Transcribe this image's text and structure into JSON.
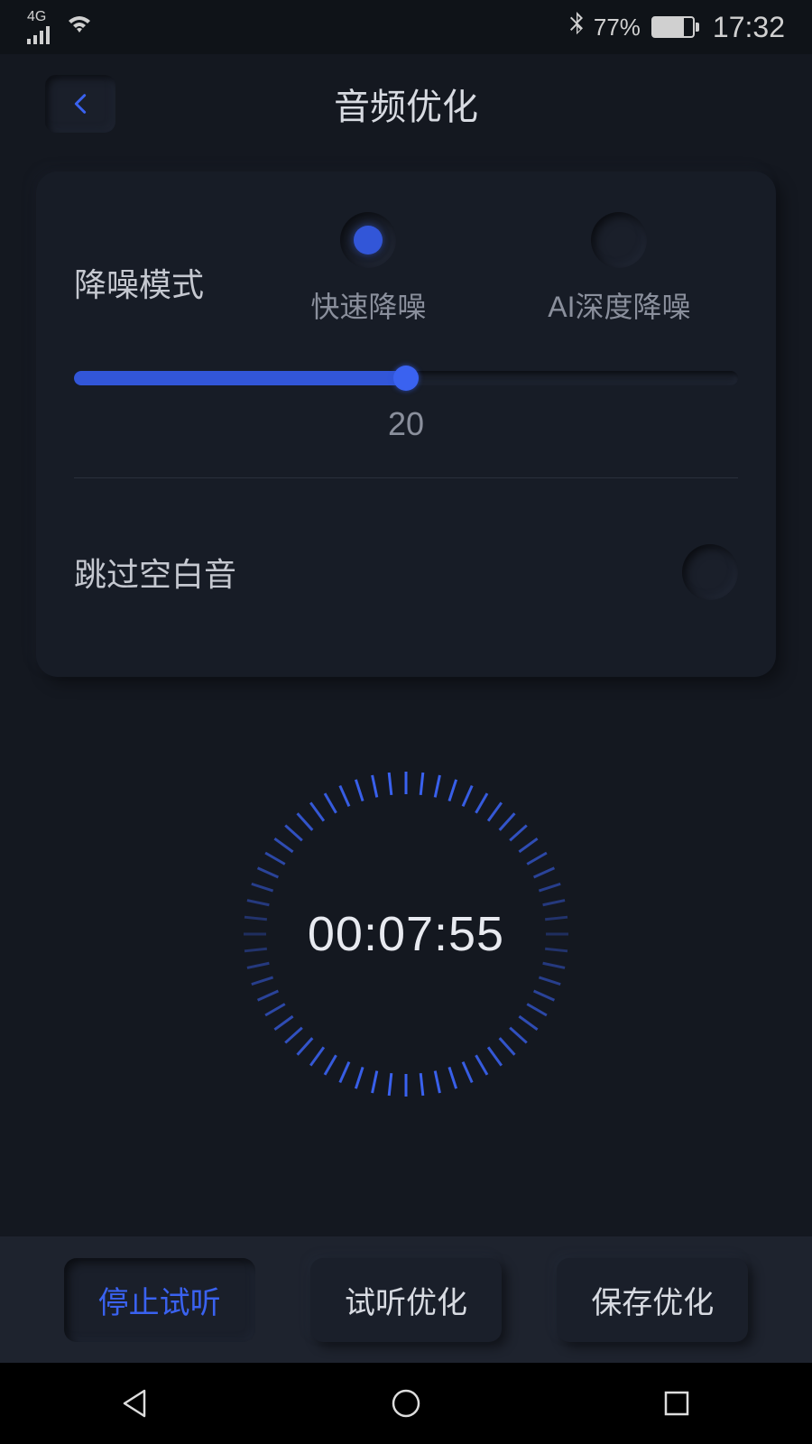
{
  "status": {
    "network": "4G",
    "battery_pct": "77%",
    "time": "17:32"
  },
  "header": {
    "title": "音频优化"
  },
  "noise": {
    "label": "降噪模式",
    "opt_fast": "快速降噪",
    "opt_ai": "AI深度降噪",
    "slider_value": "20",
    "slider_pct": 50
  },
  "skip": {
    "label": "跳过空白音"
  },
  "timer": {
    "display": "00:07:55"
  },
  "footer": {
    "stop": "停止试听",
    "preview": "试听优化",
    "save": "保存优化"
  }
}
